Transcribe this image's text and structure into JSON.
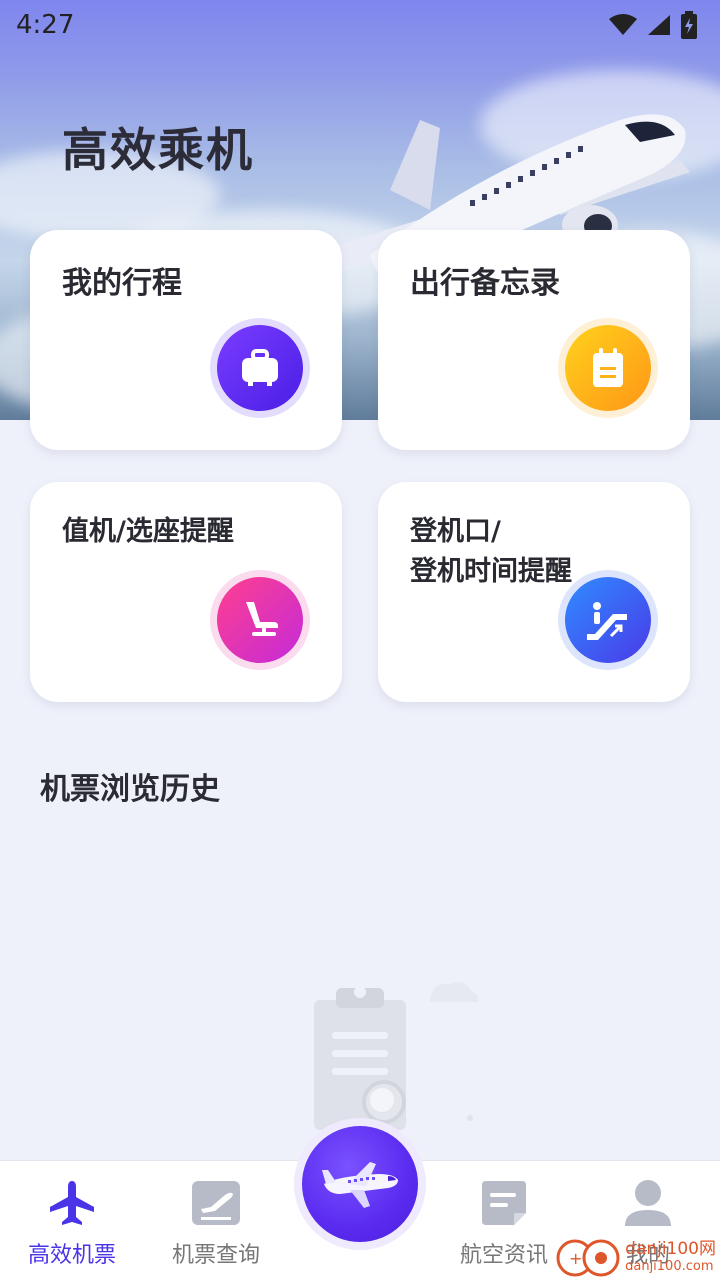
{
  "status_bar": {
    "time": "4:27"
  },
  "header": {
    "title": "高效乘机"
  },
  "cards": [
    {
      "title": "我的行程",
      "icon": "luggage-icon"
    },
    {
      "title": "出行备忘录",
      "icon": "notepad-icon"
    },
    {
      "title": "值机/选座提醒",
      "icon": "seat-icon"
    },
    {
      "title_line1": "登机口/",
      "title_line2": "登机时间提醒",
      "icon": "escalator-icon"
    }
  ],
  "history": {
    "title": "机票浏览历史"
  },
  "nav": {
    "items": [
      {
        "label": "高效机票",
        "icon": "airplane-icon",
        "active": true
      },
      {
        "label": "机票查询",
        "icon": "ticket-search-icon"
      },
      {
        "label": "航空资讯",
        "icon": "news-icon"
      },
      {
        "label": "我的",
        "icon": "profile-icon"
      }
    ],
    "center_icon": "airplane-icon"
  },
  "watermark": {
    "text": "danji100网",
    "sub": "danji100.com"
  },
  "colors": {
    "accent": "#4a34e8",
    "badge_purple": "#5a22f0",
    "badge_orange": "#ffa51a",
    "badge_pink": "#e83aa8",
    "badge_blue": "#3a5cf0"
  }
}
